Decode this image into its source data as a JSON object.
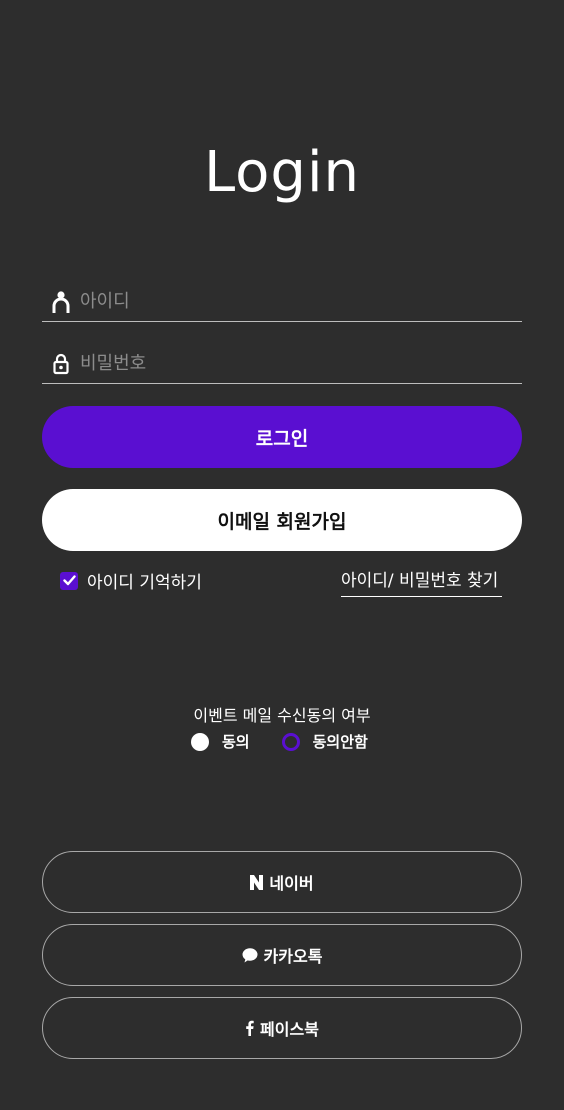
{
  "title": "Login",
  "login_form": {
    "id_placeholder": "아이디",
    "id_value": "",
    "password_placeholder": "비밀번호",
    "password_value": "",
    "login_button": "로그인",
    "signup_button": "이메일 회원가입",
    "remember_label": "아이디 기억하기",
    "remember_checked": true,
    "find_link": "아이디/ 비밀번호 찾기"
  },
  "consent": {
    "title": "이벤트 메일 수신동의 여부",
    "options": [
      "동의",
      "동의안함"
    ],
    "selected": "동의안함"
  },
  "social": {
    "naver": "네이버",
    "kakao": "카카오톡",
    "facebook": "페이스북"
  },
  "colors": {
    "background": "#2d2d2d",
    "accent": "#5a0fd1"
  }
}
